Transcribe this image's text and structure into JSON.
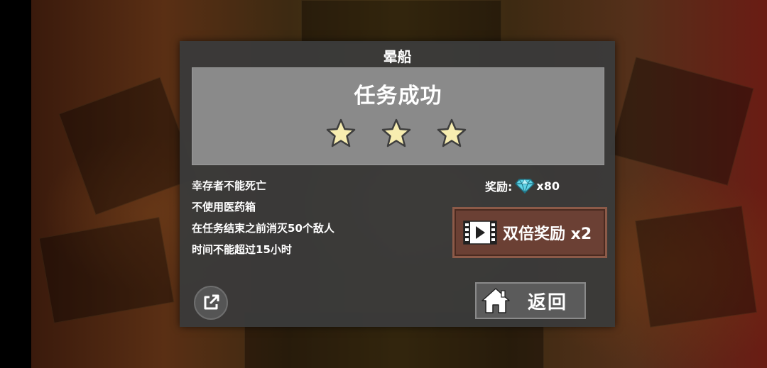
{
  "dialog": {
    "title": "晕船",
    "result_title": "任务成功",
    "stars_earned": 3,
    "stars_total": 3
  },
  "objectives": [
    "幸存者不能死亡",
    "不使用医药箱",
    "在任务结束之前消灭50个敌人",
    "时间不能超过15小时"
  ],
  "reward": {
    "label": "奖励:",
    "icon": "diamond-icon",
    "amount": "x80"
  },
  "buttons": {
    "double_reward_label": "双倍奖励 x2",
    "double_reward_icon": "video-film-icon",
    "back_label": "返回",
    "back_icon": "home-icon",
    "share_icon": "share-external-icon"
  },
  "colors": {
    "star": "#f7edb0",
    "diamond": "#5fd3e6",
    "double_button": "#6b4034"
  }
}
